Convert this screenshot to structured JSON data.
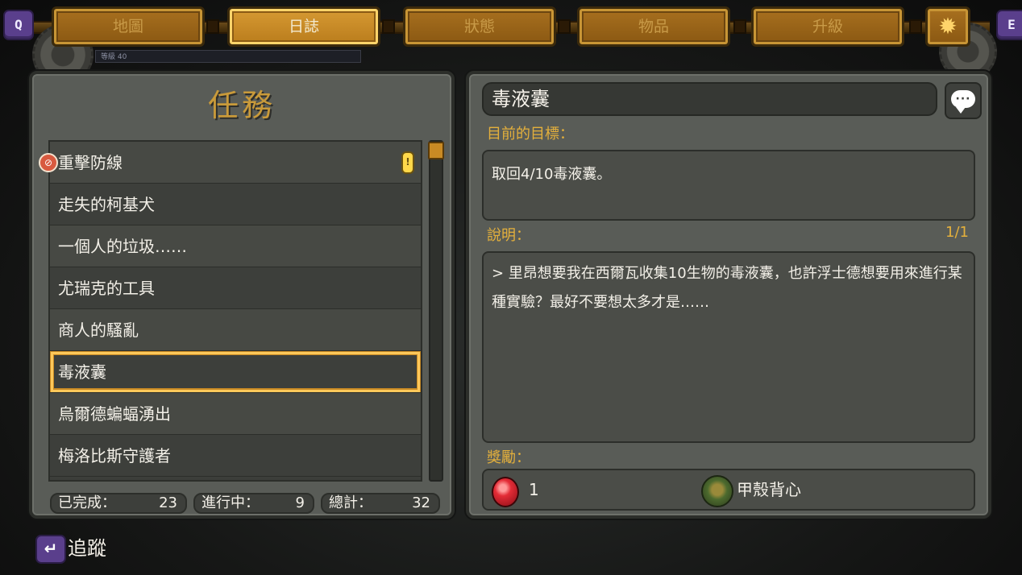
{
  "nav": {
    "left_key": "Q",
    "right_key": "E",
    "tabs": [
      "地圖",
      "日誌",
      "狀態",
      "物品",
      "升級"
    ],
    "active_tab": 1,
    "settings_icon": "gear-icon",
    "hud_text": "等級 40"
  },
  "quests": {
    "title": "任務",
    "items": [
      {
        "label": "重擊防線",
        "badge": true,
        "alert": true
      },
      {
        "label": "走失的柯基犬"
      },
      {
        "label": "一個人的垃圾……"
      },
      {
        "label": "尤瑞克的工具"
      },
      {
        "label": "商人的騷亂"
      },
      {
        "label": "毒液囊",
        "selected": true
      },
      {
        "label": "烏爾德蝙蝠湧出"
      },
      {
        "label": "梅洛比斯守護者"
      }
    ],
    "stats": {
      "completed_label": "已完成：",
      "completed_value": "23",
      "in_progress_label": "進行中：",
      "in_progress_value": "9",
      "total_label": "總計：",
      "total_value": "32"
    }
  },
  "detail": {
    "title": "毒液囊",
    "objective_label": "目前的目標：",
    "objective_text": "取回4/10毒液囊。",
    "description_label": "說明：",
    "page": "1/1",
    "description_text": "> 里昂想要我在西爾瓦收集10生物的毒液囊，也許浮士德想要用來進行某種實驗？最好不要想太多才是……",
    "rewards_label": "獎勵：",
    "reward_gem_count": "1",
    "reward_item": "甲殼背心"
  },
  "footer": {
    "track_key": "↵",
    "track_label": "追蹤"
  },
  "colors": {
    "accent_gold": "#e4b03c",
    "tab_gold": "#b97c1c",
    "selection_outline": "#ffc85a",
    "panel_gray": "#595c57",
    "key_purple": "#5a3f8c"
  }
}
